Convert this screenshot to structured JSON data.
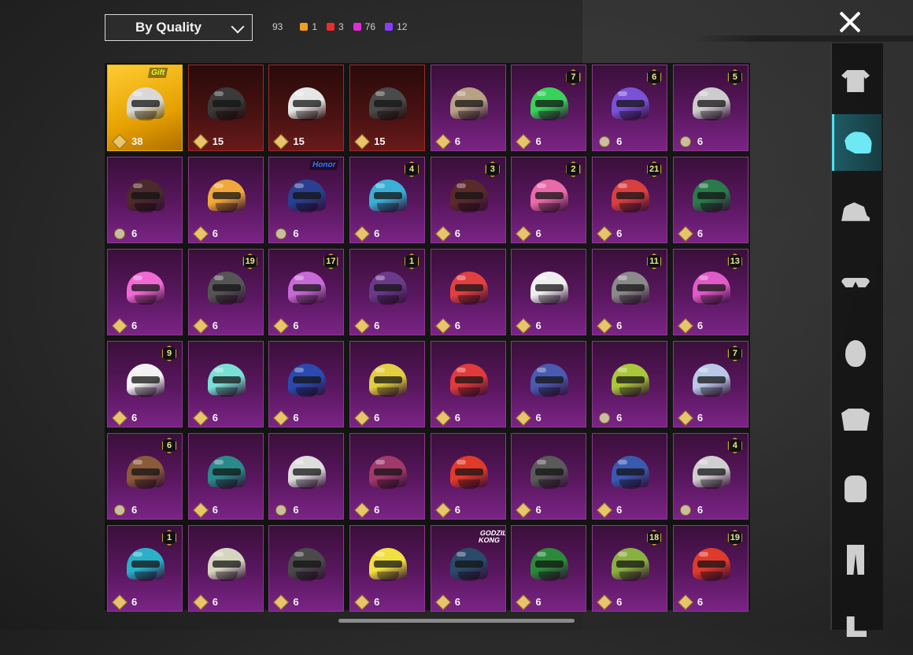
{
  "header": {
    "sort_label": "By Quality",
    "total_count": "93",
    "quality_counts": [
      {
        "color": "#f2a01c",
        "value": "1"
      },
      {
        "color": "#ee2c2c",
        "value": "3"
      },
      {
        "color": "#e62ad6",
        "value": "76"
      },
      {
        "color": "#8a3cff",
        "value": "12"
      }
    ]
  },
  "close_icon": "close-icon",
  "items": [
    {
      "quality": "gold",
      "tag": "Gift",
      "level": null,
      "coin": "diamond",
      "qty": "38",
      "color": "#d9d9d9"
    },
    {
      "quality": "red",
      "tag": null,
      "level": null,
      "coin": "diamond",
      "qty": "15",
      "color": "#3a3a3a"
    },
    {
      "quality": "red",
      "tag": null,
      "level": null,
      "coin": "diamond",
      "qty": "15",
      "color": "#e6e6e6"
    },
    {
      "quality": "red",
      "tag": null,
      "level": null,
      "coin": "diamond",
      "qty": "15",
      "color": "#4a4a4a"
    },
    {
      "quality": "purple",
      "tag": null,
      "level": null,
      "coin": "diamond",
      "qty": "6",
      "color": "#b8a184"
    },
    {
      "quality": "purple",
      "tag": null,
      "level": "7",
      "coin": "diamond",
      "qty": "6",
      "color": "#39d15a"
    },
    {
      "quality": "purple",
      "tag": null,
      "level": "6",
      "coin": "round",
      "qty": "6",
      "color": "#7a52d6"
    },
    {
      "quality": "purple",
      "tag": null,
      "level": "5",
      "coin": "round",
      "qty": "6",
      "color": "#cccccc"
    },
    {
      "quality": "purple",
      "tag": null,
      "level": null,
      "coin": "round",
      "qty": "6",
      "color": "#4a2a2a"
    },
    {
      "quality": "purple",
      "tag": null,
      "level": null,
      "coin": "diamond",
      "qty": "6",
      "color": "#f0a83a"
    },
    {
      "quality": "purple",
      "tag": "Honor",
      "level": null,
      "coin": "round",
      "qty": "6",
      "color": "#2a3f8f"
    },
    {
      "quality": "purple",
      "tag": null,
      "level": "4",
      "coin": "diamond",
      "qty": "6",
      "color": "#3ab0d6"
    },
    {
      "quality": "purple",
      "tag": null,
      "level": "3",
      "coin": "diamond",
      "qty": "6",
      "color": "#5a2a2a"
    },
    {
      "quality": "purple",
      "tag": null,
      "level": "2",
      "coin": "diamond",
      "qty": "6",
      "color": "#e86aa8"
    },
    {
      "quality": "purple",
      "tag": null,
      "level": "21",
      "coin": "diamond",
      "qty": "6",
      "color": "#d64040"
    },
    {
      "quality": "purple",
      "tag": null,
      "level": null,
      "coin": "diamond",
      "qty": "6",
      "color": "#2a7a4a"
    },
    {
      "quality": "purple",
      "tag": null,
      "level": null,
      "coin": "diamond",
      "qty": "6",
      "color": "#f06ad6"
    },
    {
      "quality": "purple",
      "tag": null,
      "level": "19",
      "coin": "diamond",
      "qty": "6",
      "color": "#555555"
    },
    {
      "quality": "purple",
      "tag": null,
      "level": "17",
      "coin": "diamond",
      "qty": "6",
      "color": "#c86ad6"
    },
    {
      "quality": "purple",
      "tag": null,
      "level": "1",
      "coin": "diamond",
      "qty": "6",
      "color": "#6a3a8a"
    },
    {
      "quality": "purple",
      "tag": null,
      "level": null,
      "coin": "diamond",
      "qty": "6",
      "color": "#e04040"
    },
    {
      "quality": "purple",
      "tag": null,
      "level": null,
      "coin": "diamond",
      "qty": "6",
      "color": "#eeeeee"
    },
    {
      "quality": "purple",
      "tag": null,
      "level": "11",
      "coin": "diamond",
      "qty": "6",
      "color": "#8a8a8a"
    },
    {
      "quality": "purple",
      "tag": null,
      "level": "13",
      "coin": "diamond",
      "qty": "6",
      "color": "#e05ac8"
    },
    {
      "quality": "purple",
      "tag": null,
      "level": "9",
      "coin": "diamond",
      "qty": "6",
      "color": "#f2f2f2"
    },
    {
      "quality": "purple",
      "tag": null,
      "level": null,
      "coin": "diamond",
      "qty": "6",
      "color": "#7ae0d6"
    },
    {
      "quality": "purple",
      "tag": null,
      "level": null,
      "coin": "diamond",
      "qty": "6",
      "color": "#2a4ab0"
    },
    {
      "quality": "purple",
      "tag": null,
      "level": null,
      "coin": "diamond",
      "qty": "6",
      "color": "#e0d040"
    },
    {
      "quality": "purple",
      "tag": null,
      "level": null,
      "coin": "diamond",
      "qty": "6",
      "color": "#e03a3a"
    },
    {
      "quality": "purple",
      "tag": null,
      "level": null,
      "coin": "diamond",
      "qty": "6",
      "color": "#4a5ab0"
    },
    {
      "quality": "purple",
      "tag": null,
      "level": null,
      "coin": "round",
      "qty": "6",
      "color": "#a8c83a"
    },
    {
      "quality": "purple",
      "tag": null,
      "level": "7",
      "coin": "diamond",
      "qty": "6",
      "color": "#b8c8e6"
    },
    {
      "quality": "purple",
      "tag": null,
      "level": "6",
      "coin": "round",
      "qty": "6",
      "color": "#8a5a3a"
    },
    {
      "quality": "purple",
      "tag": null,
      "level": null,
      "coin": "diamond",
      "qty": "6",
      "color": "#2a8a8a"
    },
    {
      "quality": "purple",
      "tag": null,
      "level": null,
      "coin": "round",
      "qty": "6",
      "color": "#dddddd"
    },
    {
      "quality": "purple",
      "tag": null,
      "level": null,
      "coin": "diamond",
      "qty": "6",
      "color": "#a03a6a"
    },
    {
      "quality": "purple",
      "tag": null,
      "level": null,
      "coin": "diamond",
      "qty": "6",
      "color": "#e03a2a"
    },
    {
      "quality": "purple",
      "tag": null,
      "level": null,
      "coin": "diamond",
      "qty": "6",
      "color": "#5a5a5a"
    },
    {
      "quality": "purple",
      "tag": null,
      "level": null,
      "coin": "diamond",
      "qty": "6",
      "color": "#3a5ab0"
    },
    {
      "quality": "purple",
      "tag": null,
      "level": "4",
      "coin": "round",
      "qty": "6",
      "color": "#cfcfcf"
    },
    {
      "quality": "purple",
      "tag": null,
      "level": "1",
      "coin": "diamond",
      "qty": "6",
      "color": "#2ab0c8"
    },
    {
      "quality": "purple",
      "tag": null,
      "level": null,
      "coin": "diamond",
      "qty": "6",
      "color": "#d6d6c0"
    },
    {
      "quality": "purple",
      "tag": null,
      "level": null,
      "coin": "diamond",
      "qty": "6",
      "color": "#4a4a4a"
    },
    {
      "quality": "purple",
      "tag": null,
      "level": null,
      "coin": "diamond",
      "qty": "6",
      "color": "#f0e040"
    },
    {
      "quality": "purple",
      "tag": "GODZILLA KONG",
      "level": null,
      "coin": "diamond",
      "qty": "6",
      "color": "#2a4a6a"
    },
    {
      "quality": "purple",
      "tag": null,
      "level": null,
      "coin": "diamond",
      "qty": "6",
      "color": "#2a8a3a"
    },
    {
      "quality": "purple",
      "tag": null,
      "level": "18",
      "coin": "diamond",
      "qty": "6",
      "color": "#8ab040"
    },
    {
      "quality": "purple",
      "tag": null,
      "level": "19",
      "coin": "diamond",
      "qty": "6",
      "color": "#e03a2a"
    }
  ],
  "side_tabs": [
    {
      "icon": "shirt-set-icon",
      "active": false
    },
    {
      "icon": "helmet-icon",
      "active": true
    },
    {
      "icon": "cap-icon",
      "active": false
    },
    {
      "icon": "glasses-icon",
      "active": false
    },
    {
      "icon": "mask-icon",
      "active": false
    },
    {
      "icon": "jacket-icon",
      "active": false
    },
    {
      "icon": "backpack-icon",
      "active": false
    },
    {
      "icon": "pants-icon",
      "active": false
    },
    {
      "icon": "boots-icon",
      "active": false
    }
  ]
}
